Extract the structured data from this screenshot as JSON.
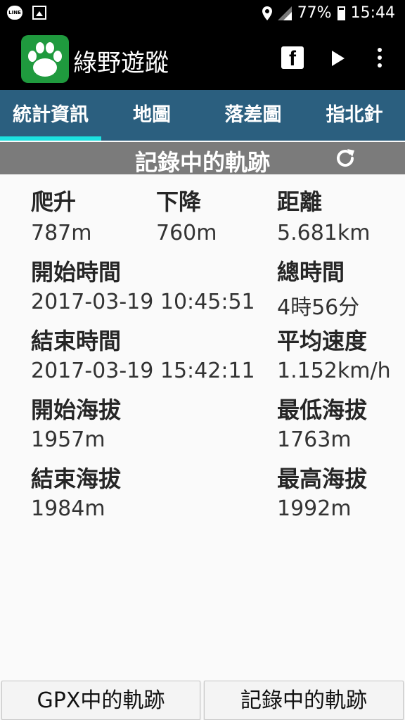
{
  "status_bar": {
    "battery": "77%",
    "time": "15:44",
    "line_badge": "LINE"
  },
  "app": {
    "title": "綠野遊蹤",
    "fb_label": "f"
  },
  "tabs": [
    {
      "label": "統計資訊",
      "active": true
    },
    {
      "label": "地圖",
      "active": false
    },
    {
      "label": "落差圖",
      "active": false
    },
    {
      "label": "指北針",
      "active": false
    }
  ],
  "section": {
    "title": "記錄中的軌跡"
  },
  "stats": {
    "climb": {
      "label": "爬升",
      "value": "787m"
    },
    "descent": {
      "label": "下降",
      "value": "760m"
    },
    "distance": {
      "label": "距離",
      "value": "5.681km"
    },
    "start_time": {
      "label": "開始時間",
      "value": "2017-03-19 10:45:51"
    },
    "total_time": {
      "label": "總時間",
      "value": "4時56分"
    },
    "end_time": {
      "label": "結束時間",
      "value": "2017-03-19 15:42:11"
    },
    "avg_speed": {
      "label": "平均速度",
      "value": "1.152km/h"
    },
    "start_alt": {
      "label": "開始海拔",
      "value": "1957m"
    },
    "min_alt": {
      "label": "最低海拔",
      "value": "1763m"
    },
    "end_alt": {
      "label": "結束海拔",
      "value": "1984m"
    },
    "max_alt": {
      "label": "最高海拔",
      "value": "1992m"
    }
  },
  "bottom": {
    "gpx_button": "GPX中的軌跡",
    "record_button": "記錄中的軌跡"
  },
  "colors": {
    "tab_bg": "#2b5f7f",
    "tab_indicator": "#1ce1e0",
    "logo_green": "#1f9a3e"
  }
}
